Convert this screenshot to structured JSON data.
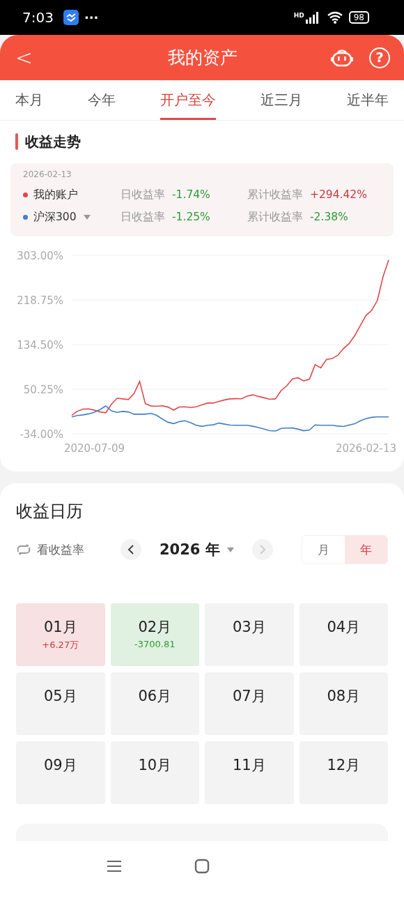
{
  "status_bar": {
    "time": "7:03",
    "more": "···",
    "network": "HD",
    "battery": "98"
  },
  "header": {
    "back": "<",
    "title": "我的资产",
    "help": "?"
  },
  "tabs": [
    {
      "label": "本月",
      "selected": false
    },
    {
      "label": "今年",
      "selected": false
    },
    {
      "label": "开户至今",
      "selected": true
    },
    {
      "label": "近三月",
      "selected": false
    },
    {
      "label": "近半年",
      "selected": false
    }
  ],
  "trend": {
    "title": "收益走势",
    "date": "2026-02-13",
    "legend": [
      {
        "dropdown": false,
        "daily_label": "日收益率",
        "daily": {
          "text": "-1.74%",
          "color": "#2e9a33"
        },
        "total_label": "累计收益率",
        "total": {
          "text": "+294.42%",
          "color": "#c8383e"
        }
      },
      {
        "dropdown": true,
        "daily_label": "日收益率",
        "daily": {
          "text": "-1.25%",
          "color": "#2e9a33"
        },
        "total_label": "累计收益率",
        "total": {
          "text": "-2.38%",
          "color": "#2e9a33"
        }
      }
    ],
    "chart_data": {
      "type": "line",
      "grid": true,
      "categories": [
        null,
        null,
        null,
        null,
        "2020-07-09",
        null,
        null,
        null,
        null,
        null,
        null,
        null,
        null,
        null,
        null,
        null,
        null,
        null,
        null,
        null,
        null,
        null,
        null,
        null,
        null,
        null,
        null,
        null,
        null,
        null,
        null,
        null,
        null,
        null,
        null,
        null,
        null,
        null,
        null,
        null,
        null,
        null,
        null,
        null,
        null,
        null,
        null,
        null,
        null,
        null,
        null,
        null,
        "2026-02-13",
        null,
        null,
        null,
        null
      ],
      "ylim": [
        -34,
        303
      ],
      "yticks": [
        {
          "value": 303,
          "label": "303.00%"
        },
        {
          "value": 218.75,
          "label": "218.75%"
        },
        {
          "value": 134.5,
          "label": "134.50%"
        },
        {
          "value": 50.25,
          "label": "50.25%"
        },
        {
          "value": -34,
          "label": "-34.00%"
        }
      ],
      "series": [
        {
          "name": "我的账户",
          "color": "#e0474c",
          "values": [
            1,
            8.6,
            12.7,
            13,
            10.6,
            7.4,
            5.8,
            21.7,
            33.2,
            32,
            30.7,
            42,
            65,
            23,
            18.5,
            18,
            19,
            16.6,
            10.8,
            16.7,
            17,
            15.7,
            16.9,
            20.6,
            24,
            24,
            27.3,
            30,
            32,
            32.3,
            32.1,
            37.1,
            39.6,
            36.5,
            33.9,
            31.1,
            32,
            47.6,
            56.8,
            69.7,
            71.7,
            65.9,
            69.3,
            96.4,
            90.5,
            106.2,
            108,
            114.1,
            126.8,
            136.2,
            151.3,
            170.4,
            189.7,
            199,
            217.7,
            262.6,
            294
          ]
        },
        {
          "name": "沪深300",
          "color": "#3f7fc6",
          "values": [
            -2,
            0.5,
            1.7,
            3.6,
            6.8,
            11.8,
            18.6,
            9.3,
            6.6,
            8.2,
            7.3,
            3,
            3,
            3,
            4.5,
            0.9,
            -5.9,
            -12.1,
            -14.6,
            -11.1,
            -9.4,
            -12.8,
            -17.8,
            -20.1,
            -17.9,
            -17,
            -13.7,
            -15.7,
            -17.5,
            -18,
            -18,
            -18,
            -19.7,
            -22.1,
            -25.2,
            -28.1,
            -28.7,
            -23.9,
            -23.1,
            -23,
            -25.3,
            -28.2,
            -26.8,
            -17.1,
            -17.9,
            -18,
            -18,
            -19.4,
            -20.2,
            -17.6,
            -15.1,
            -9.4,
            -5.4,
            -2.9,
            -2,
            -2,
            -2
          ]
        }
      ]
    }
  },
  "calendar": {
    "title": "收益日历",
    "toggle": "看收益率",
    "year": "2026 年",
    "prev_disabled": false,
    "next_disabled": true,
    "modes": [
      {
        "label": "月",
        "selected": false
      },
      {
        "label": "年",
        "selected": true
      }
    ],
    "months": [
      {
        "label": "01月",
        "amount": "+6.27万",
        "color": "#c8383e"
      },
      {
        "label": "02月",
        "amount": "-3700.81",
        "color": "#2e9a33"
      },
      {
        "label": "03月"
      },
      {
        "label": "04月"
      },
      {
        "label": "05月"
      },
      {
        "label": "06月"
      },
      {
        "label": "07月"
      },
      {
        "label": "08月"
      },
      {
        "label": "09月"
      },
      {
        "label": "10月"
      },
      {
        "label": "11月"
      },
      {
        "label": "12月"
      }
    ]
  }
}
